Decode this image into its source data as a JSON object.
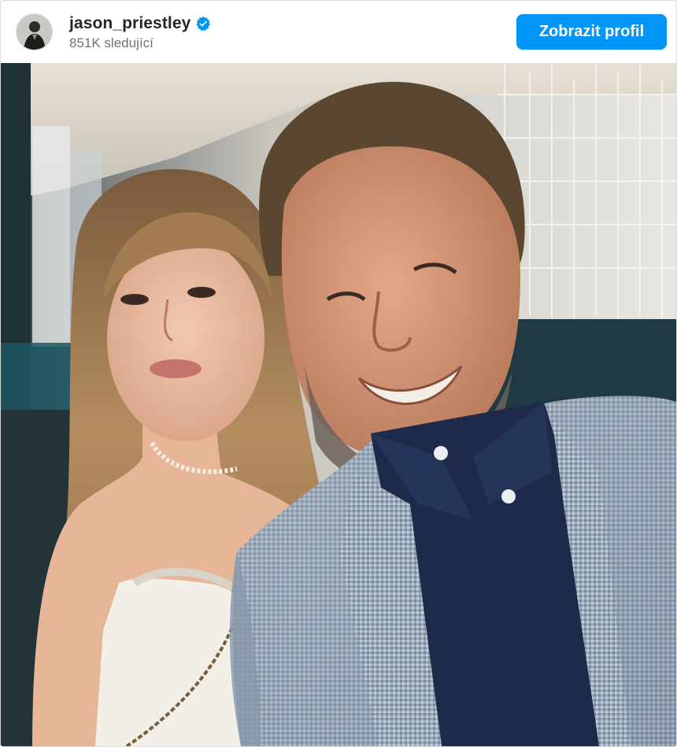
{
  "post": {
    "username": "jason_priestley",
    "followers": "851K sledující",
    "verified": true,
    "view_profile_label": "Zobrazit profil",
    "accent_color": "#0095f6",
    "photo_subject": "selfie-photo"
  }
}
